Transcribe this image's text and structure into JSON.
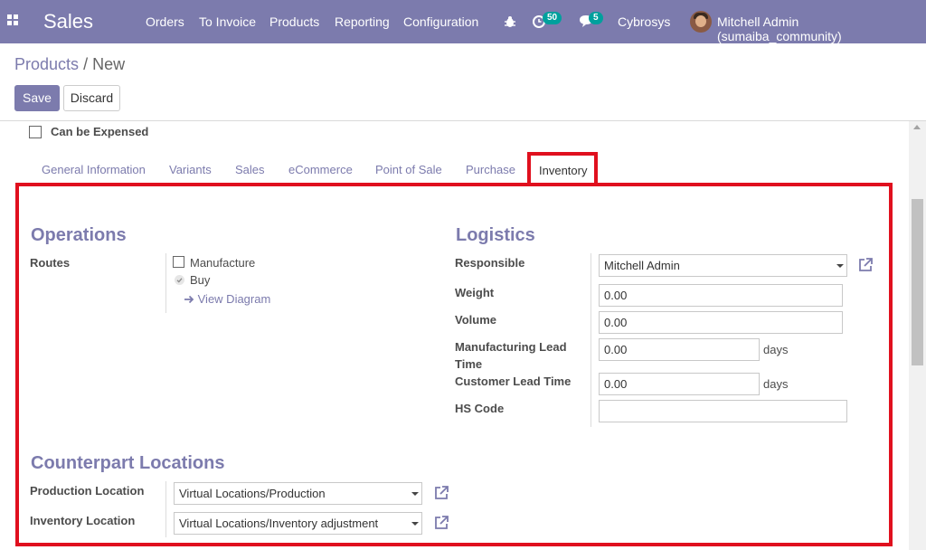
{
  "navbar": {
    "app_name": "Sales",
    "menu": [
      "Orders",
      "To Invoice",
      "Products",
      "Reporting",
      "Configuration"
    ],
    "activity_count": "50",
    "message_count": "5",
    "company": "Cybrosys",
    "user": "Mitchell Admin (sumaiba_community)",
    "icons": [
      "apps-grid-icon",
      "bug-icon",
      "activity-clock-icon",
      "chat-bubble-icon"
    ]
  },
  "breadcrumb": {
    "parent": "Products",
    "separator": "/",
    "current": "New"
  },
  "buttons": {
    "save": "Save",
    "discard": "Discard"
  },
  "expense": {
    "label": "Can be Expensed",
    "checked": false
  },
  "tabs": [
    "General Information",
    "Variants",
    "Sales",
    "eCommerce",
    "Point of Sale",
    "Purchase",
    "Inventory"
  ],
  "active_tab": "Inventory",
  "operations": {
    "title": "Operations",
    "routes_label": "Routes",
    "routes": [
      {
        "label": "Manufacture",
        "checked": false
      },
      {
        "label": "Buy",
        "checked": true
      }
    ],
    "view_diagram": "View Diagram"
  },
  "logistics": {
    "title": "Logistics",
    "responsible_label": "Responsible",
    "responsible_value": "Mitchell Admin",
    "weight_label": "Weight",
    "weight_value": "0.00",
    "volume_label": "Volume",
    "volume_value": "0.00",
    "mfg_lead_label_line1": "Manufacturing Lead",
    "mfg_lead_label_line2": "Time",
    "mfg_lead_value": "0.00",
    "mfg_lead_unit": "days",
    "customer_lead_label": "Customer Lead Time",
    "customer_lead_value": "0.00",
    "customer_lead_unit": "days",
    "hs_code_label": "HS Code",
    "hs_code_value": ""
  },
  "counterpart": {
    "title": "Counterpart Locations",
    "production_label": "Production Location",
    "production_value": "Virtual Locations/Production",
    "inventory_label": "Inventory Location",
    "inventory_value": "Virtual Locations/Inventory adjustment"
  },
  "colors": {
    "brand": "#7c7bad",
    "highlight": "#e0101e",
    "badge": "#00a09d"
  }
}
